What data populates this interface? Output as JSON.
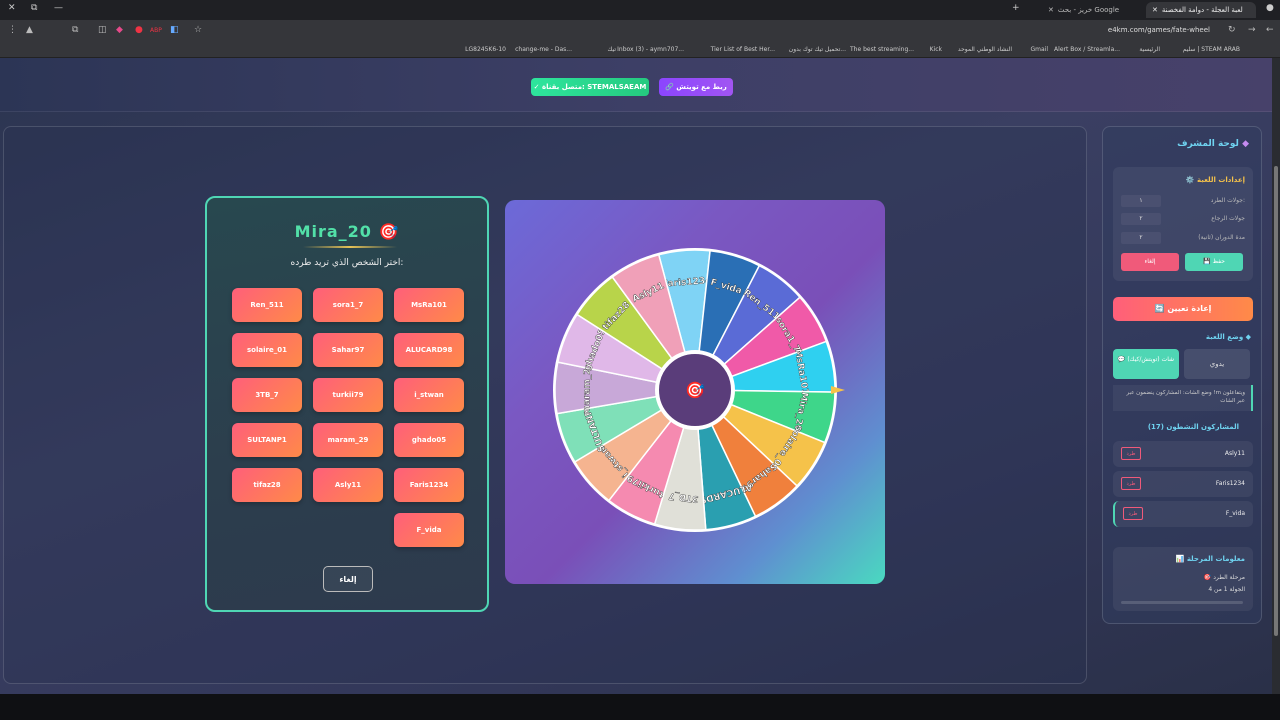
{
  "browser": {
    "tabs": [
      {
        "title": "لعبة العجلة - دوامة الفخصنة"
      },
      {
        "title": "خريز - بحث Google"
      }
    ],
    "url": "e4km.com/games/fate-wheel",
    "bookmarks": [
      "سليم | STEAM ARAB",
      "الرئيسية",
      "Alert Box / Streamla...",
      "Gmail",
      "النشاد الوطني الموحد",
      "Kick",
      "The best streaming...",
      "تحميل تيك توك بدون...",
      "Tier List of Best Her...",
      "Inbox (3) - aymn707...",
      "تيك",
      "change-me - Das...",
      "LG8245K6-10"
    ]
  },
  "header": {
    "connected_label": "✓ متصل بقناة: STEMALSAEAM",
    "link_label": "🔗 ربط مع تويتش"
  },
  "elimination": {
    "player_name": "Mira_20",
    "target_icon": "🎯",
    "prompt": "اختر الشخص الذي تريد طرده:",
    "players": [
      "MsRa101",
      "sora1_7",
      "Ren_511",
      "ALUCARD98",
      "Sahar97",
      "solaire_01",
      "i_stwan",
      "turkii79",
      "3TB_7",
      "ghado05",
      "maram_29",
      "SULTANP1",
      "Faris1234",
      "Asly11",
      "tifaz28",
      "F_vida"
    ],
    "cancel_label": "إلغاء"
  },
  "wheel": {
    "center_icon": "🎯",
    "segments": [
      {
        "name": "Faris1234",
        "color": "#7fd3f5"
      },
      {
        "name": "F_vida",
        "color": "#2a6fb5"
      },
      {
        "name": "Ren_511",
        "color": "#5a6bd6"
      },
      {
        "name": "sora1_7",
        "color": "#f05aa8"
      },
      {
        "name": "MsRa101",
        "color": "#2fd0f0"
      },
      {
        "name": "Mira_20",
        "color": "#3ed68a"
      },
      {
        "name": "solaire_01",
        "color": "#f5c24a"
      },
      {
        "name": "Sahar97",
        "color": "#f0803c"
      },
      {
        "name": "ALUCARD98",
        "color": "#2a9fb0"
      },
      {
        "name": "3TB_7",
        "color": "#e0e0d8"
      },
      {
        "name": "turkii79",
        "color": "#f58ab0"
      },
      {
        "name": "i_stwan",
        "color": "#f5b490"
      },
      {
        "name": "SULTANP1",
        "color": "#7fe0b8"
      },
      {
        "name": "maram_29",
        "color": "#c8a8d8"
      },
      {
        "name": "ghado05",
        "color": "#e0b8e8"
      },
      {
        "name": "tifaz28",
        "color": "#b8d44a"
      },
      {
        "name": "Asly11",
        "color": "#f0a0b8"
      }
    ]
  },
  "sidebar": {
    "title": "لوحة المشرف",
    "settings": {
      "title": "⚙️ إعدادات اللعبة",
      "fields": [
        {
          "label": "جولات الطرد:",
          "value": "١"
        },
        {
          "label": "جولات الرجاع",
          "value": "٢"
        },
        {
          "label": "مدة الدوران (ثانية)",
          "value": "٢"
        }
      ],
      "save_label": "💾 حفظ",
      "cancel_label": "إلغاء"
    },
    "reset_label": "🔄 إعادة تعيين",
    "mode": {
      "title": "وضع اللعبة",
      "chat_label": "💬 شات (تويتش/كيك)",
      "manual_label": "يدوي",
      "note": "وضع الشات: المشاركون ينضمون عبر !m ويتفاعلون عبر الشات"
    },
    "participants": {
      "title": "المشاركون النشطون (17)",
      "kick_label": "طرد",
      "visible": [
        "Asly11",
        "Faris1234",
        "F_vida"
      ]
    },
    "stage": {
      "title": "📊 معلومات المرحلة",
      "phase": "🎯 مرحلة الطرد",
      "round": "الجولة 1 من 4"
    }
  }
}
